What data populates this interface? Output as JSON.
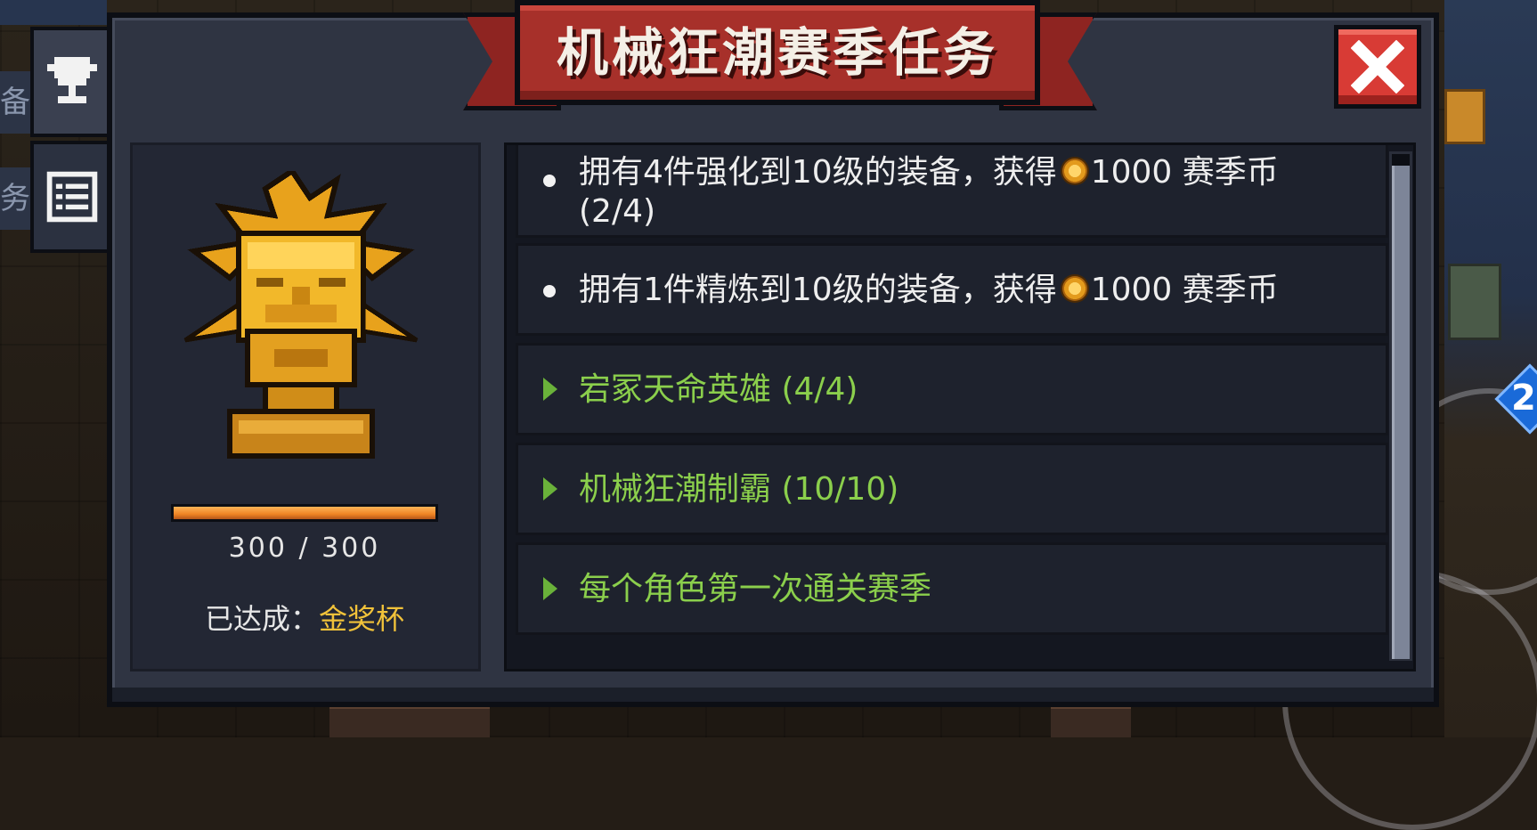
{
  "window": {
    "title": "机械狂潮赛季任务",
    "close_label": "close"
  },
  "side_tabs": [
    {
      "icon": "trophy-icon",
      "active": true
    },
    {
      "icon": "list-icon",
      "active": false
    }
  ],
  "background": {
    "left_hint_1": "备",
    "left_hint_2": "务",
    "joystick_number": "2"
  },
  "progress": {
    "current": 300,
    "max": 300,
    "text": "300 / 300"
  },
  "achievement": {
    "label": "已达成：",
    "value": "金奖杯"
  },
  "tasks": [
    {
      "type": "bullet",
      "completed": false,
      "text_line1_prefix": "拥有4件强化到10级的装备，获得",
      "reward": "1000 赛季币",
      "text_line2": "(2/4)"
    },
    {
      "type": "bullet",
      "completed": false,
      "text_line1_prefix": "拥有1件精炼到10级的装备，获得",
      "reward": "1000 赛季币"
    },
    {
      "type": "group",
      "completed": true,
      "text": "宕冢天命英雄 (4/4)"
    },
    {
      "type": "group",
      "completed": true,
      "text": "机械狂潮制霸 (10/10)"
    },
    {
      "type": "group",
      "completed": true,
      "text": "每个角色第一次通关赛季"
    }
  ],
  "colors": {
    "ribbon": "#a7302a",
    "close": "#d83b35",
    "completed_text": "#8bcf4c",
    "gold": "#f1c23a",
    "progress": "#ef8424"
  }
}
